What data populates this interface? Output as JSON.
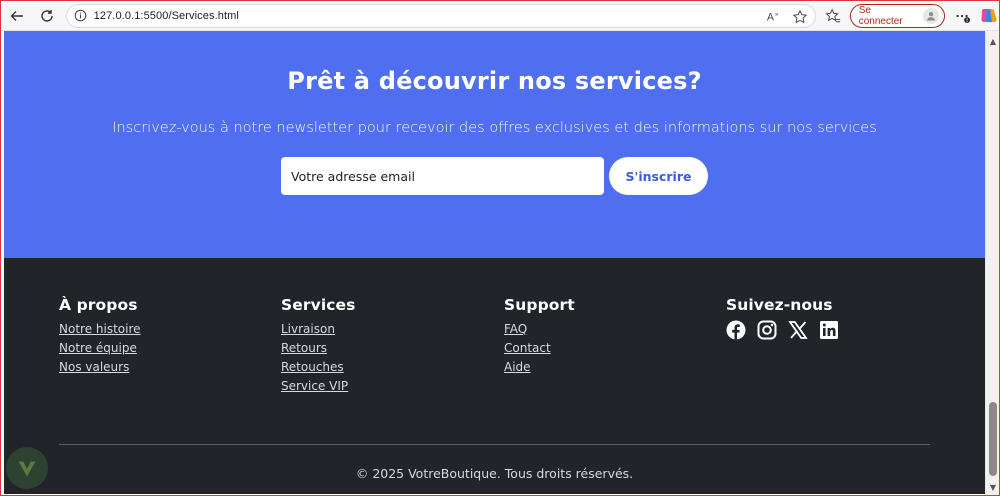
{
  "browser": {
    "url": "127.0.0.1:5500/Services.html",
    "signin_label": "Se connecter"
  },
  "newsletter": {
    "title": "Prêt à découvrir nos services?",
    "subtitle": "Inscrivez-vous à notre newsletter pour recevoir des offres exclusives et des informations sur nos services",
    "email_placeholder": "Votre adresse email",
    "button_label": "S'inscrire"
  },
  "footer": {
    "columns": [
      {
        "title": "À propos",
        "links": [
          "Notre histoire",
          "Notre équipe",
          "Nos valeurs"
        ]
      },
      {
        "title": "Services",
        "links": [
          "Livraison",
          "Retours",
          "Retouches",
          "Service VIP"
        ]
      },
      {
        "title": "Support",
        "links": [
          "FAQ",
          "Contact",
          "Aide"
        ]
      },
      {
        "title": "Suivez-nous",
        "socials": [
          "facebook-icon",
          "instagram-icon",
          "x-icon",
          "linkedin-icon"
        ]
      }
    ],
    "copyright": "© 2025 VotreBoutique. Tous droits réservés."
  },
  "colors": {
    "newsletter_bg": "#4f6ff0",
    "footer_bg": "#212529",
    "accent": "#3d5ad8",
    "signin": "#b3261e"
  }
}
